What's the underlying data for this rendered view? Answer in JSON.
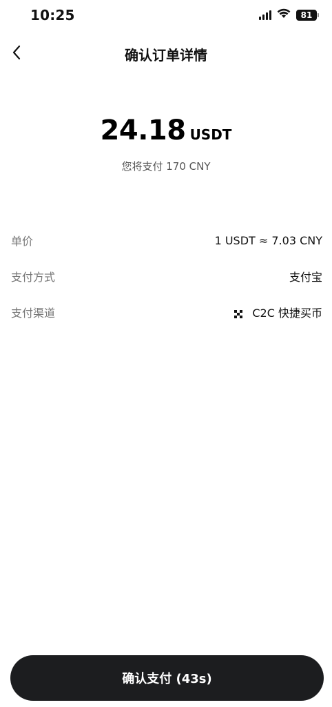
{
  "status_bar": {
    "time": "10:25",
    "battery": "81"
  },
  "header": {
    "title": "确认订单详情",
    "back_icon": "chevron-left-icon"
  },
  "amount": {
    "value": "24.18",
    "unit": "USDT",
    "subtitle": "您将支付 170 CNY"
  },
  "details": {
    "price": {
      "label": "单价",
      "value": "1 USDT ≈ 7.03 CNY"
    },
    "payment_method": {
      "label": "支付方式",
      "value": "支付宝"
    },
    "payment_channel": {
      "label": "支付渠道",
      "value": "C2C 快捷买币",
      "icon": "c2c-icon"
    }
  },
  "actions": {
    "confirm_label": "确认支付 (43s)"
  }
}
